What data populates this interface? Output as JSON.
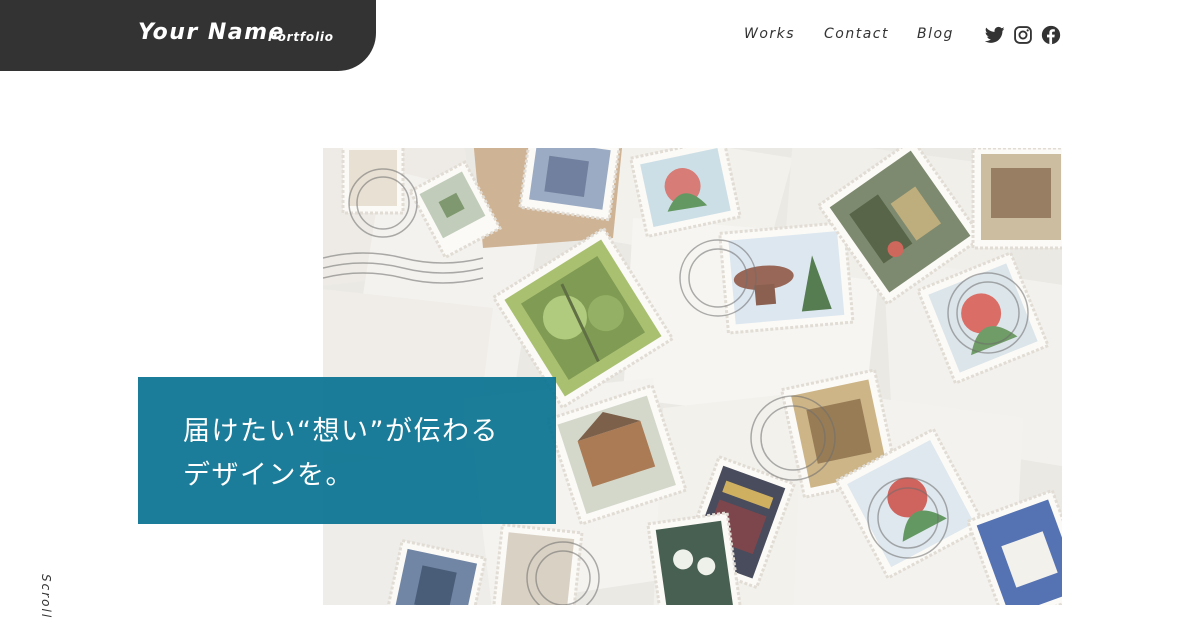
{
  "header": {
    "logo_name": "Your Name",
    "logo_sub": "Portfolio",
    "nav": [
      "Works",
      "Contact",
      "Blog"
    ],
    "social": [
      "twitter-icon",
      "instagram-icon",
      "facebook-icon"
    ]
  },
  "hero": {
    "tagline_line1": "届けたい“想い”が伝わる",
    "tagline_line2": "デザインを。",
    "image": "postage-stamps-photo"
  },
  "scroll_label": "Scroll",
  "colors": {
    "header_bg": "#333333",
    "accent_teal": "#0A7391",
    "text": "#333333",
    "background": "#FFFFFF"
  }
}
